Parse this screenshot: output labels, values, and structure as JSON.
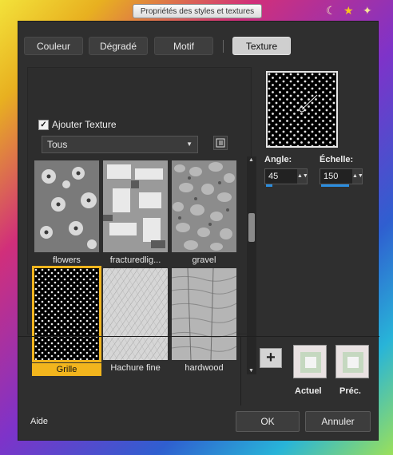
{
  "window": {
    "title": "Propriétés des styles et textures"
  },
  "tabs": [
    {
      "label": "Couleur",
      "active": false
    },
    {
      "label": "Dégradé",
      "active": false
    },
    {
      "label": "Motif",
      "active": false
    },
    {
      "label": "Texture",
      "active": true
    }
  ],
  "texture": {
    "add_texture_label": "Ajouter Texture",
    "add_texture_checked": true,
    "category_select": "Tous",
    "thumbnails": [
      {
        "label": "flowers",
        "selected": false
      },
      {
        "label": "fracturedlig...",
        "selected": false
      },
      {
        "label": "gravel",
        "selected": false
      },
      {
        "label": "Grille",
        "selected": true
      },
      {
        "label": "Hachure fine",
        "selected": false
      },
      {
        "label": "hardwood",
        "selected": false
      }
    ]
  },
  "controls": {
    "angle_label": "Angle:",
    "angle_value": "45",
    "scale_label": "Échelle:",
    "scale_value": "150"
  },
  "swatches": {
    "add_button": "+",
    "current_label": "Actuel",
    "previous_label": "Préc."
  },
  "footer": {
    "help": "Aide",
    "ok": "OK",
    "cancel": "Annuler"
  },
  "colors": {
    "accent_selected": "#f2b51d",
    "slider_blue": "#2b8ee0"
  }
}
